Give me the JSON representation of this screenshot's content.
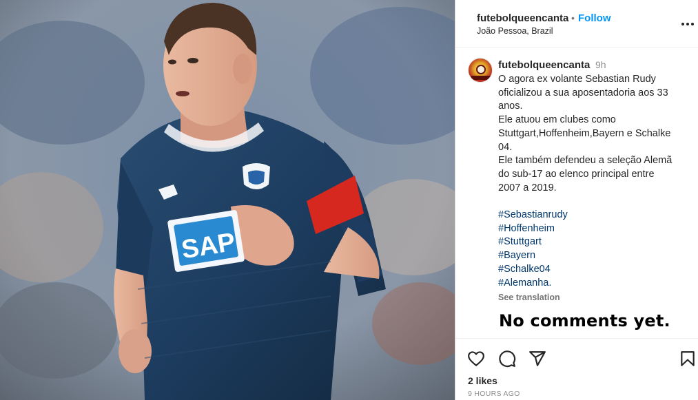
{
  "post": {
    "username": "futebolqueencanta",
    "separator": "•",
    "follow_label": "Follow",
    "location": "João Pessoa, Brazil",
    "more_icon": "more-horizontal-icon"
  },
  "caption": {
    "username": "futebolqueencanta",
    "time": "9h",
    "lines": [
      "O agora ex volante Sebastian Rudy",
      "oficializou a sua aposentadoria aos 33",
      "anos.",
      "Ele atuou em clubes como",
      "Stuttgart,Hoffenheim,Bayern e Schalke",
      "04.",
      "Ele também defendeu a seleção Alemã",
      "do sub-17 ao elenco principal entre",
      "2007 a 2019.",
      ""
    ],
    "hashtags": [
      "#Sebastianrudy",
      "#Hoffenheim",
      "#Stuttgart",
      "#Bayern",
      "#Schalke04",
      "#Alemanha."
    ],
    "see_translation": "See translation"
  },
  "comments": {
    "empty_text": "No comments yet."
  },
  "actions": {
    "likes": "2 likes",
    "timestamp": "9 HOURS AGO",
    "icons": [
      "heart-icon",
      "comment-icon",
      "share-icon",
      "bookmark-icon"
    ]
  },
  "media": {
    "jersey_sponsor": "SAP"
  },
  "colors": {
    "follow": "#0095f6",
    "hashtag": "#00376b",
    "jersey": "#1e3c5e",
    "armband": "#d6281f"
  }
}
